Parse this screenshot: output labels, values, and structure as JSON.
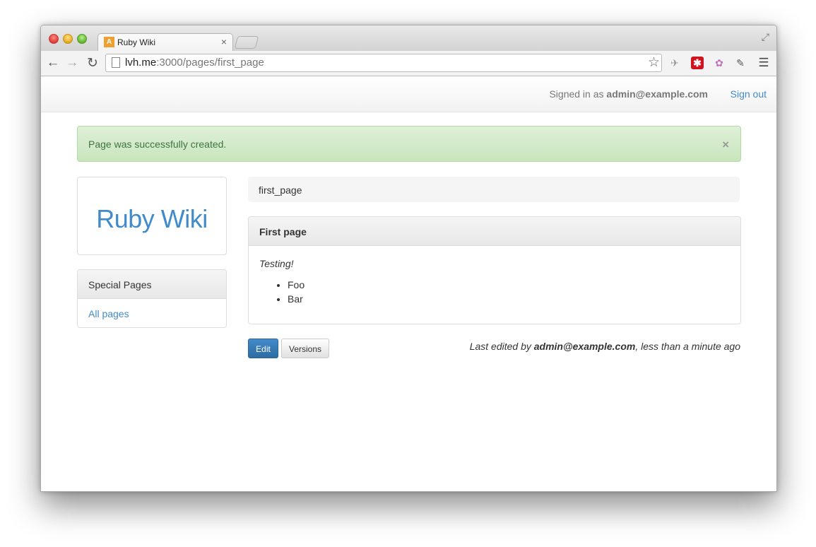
{
  "browser": {
    "tab_title": "Ruby Wiki",
    "tab_close": "×",
    "favicon_glyph": "A",
    "url_host": "lvh.me",
    "url_path": ":3000/pages/first_page"
  },
  "navbar": {
    "signed_in_prefix": "Signed in as ",
    "user_email": "admin@example.com",
    "sign_out": "Sign out"
  },
  "alert": {
    "message": "Page was successfully created.",
    "close": "×"
  },
  "sidebar": {
    "logo": "Ruby Wiki",
    "special_title": "Special Pages",
    "links": [
      "All pages"
    ]
  },
  "page": {
    "breadcrumb": "first_page",
    "title": "First page",
    "intro": "Testing!",
    "items": [
      "Foo",
      "Bar"
    ]
  },
  "actions": {
    "edit": "Edit",
    "versions": "Versions"
  },
  "footer": {
    "last_edited_prefix": "Last edited by ",
    "last_edited_user": "admin@example.com",
    "last_edited_suffix": ", less than a minute ago"
  },
  "colors": {
    "link": "#428bca",
    "success_bg": "#dff0d8",
    "success_text": "#3c763d"
  }
}
